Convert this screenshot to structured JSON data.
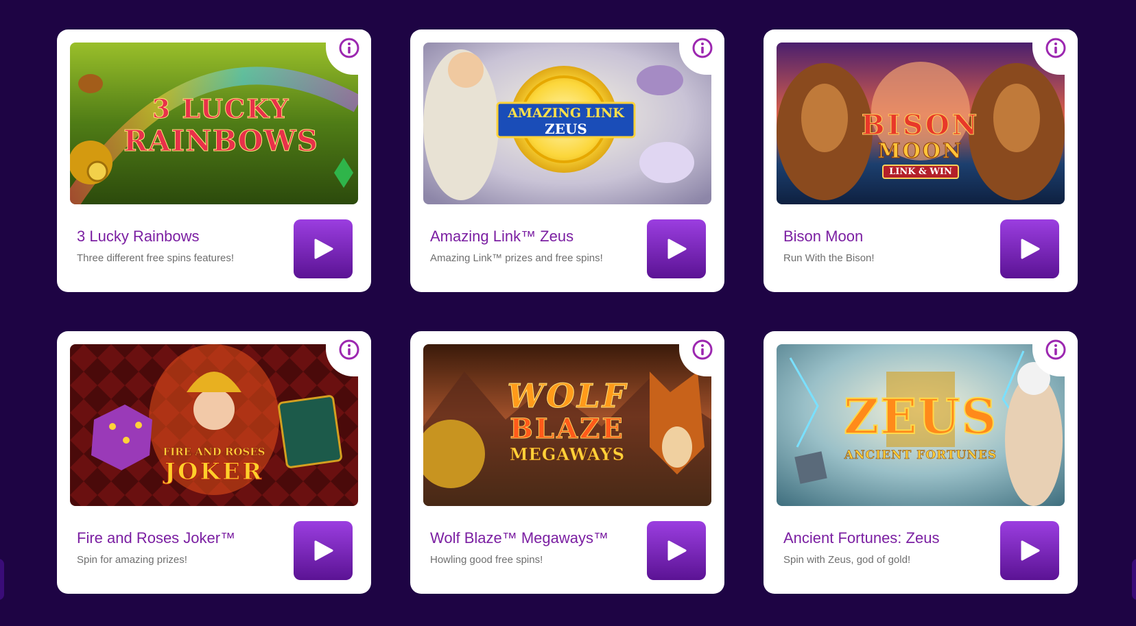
{
  "games": [
    {
      "title": "3 Lucky Rainbows",
      "subtitle": "Three different free spins features!",
      "logo_lines": [
        "3 LUCKY",
        "RAINBOWS"
      ]
    },
    {
      "title": "Amazing Link™ Zeus",
      "subtitle": "Amazing Link™ prizes and free spins!",
      "logo_lines": [
        "AMAZING LINK",
        "ZEUS"
      ]
    },
    {
      "title": "Bison Moon",
      "subtitle": "Run With the Bison!",
      "logo_lines": [
        "BISON",
        "MOON",
        "LINK & WIN"
      ]
    },
    {
      "title": "Fire and Roses Joker™",
      "subtitle": "Spin for amazing prizes!",
      "logo_lines": [
        "FIRE AND ROSES",
        "JOKER"
      ]
    },
    {
      "title": "Wolf Blaze™ Megaways™",
      "subtitle": "Howling good free spins!",
      "logo_lines": [
        "WOLF",
        "BLAZE",
        "MEGAWAYS"
      ]
    },
    {
      "title": "Ancient Fortunes: Zeus",
      "subtitle": "Spin with Zeus, god of gold!",
      "logo_lines": [
        "ZEUS",
        "ANCIENT FORTUNES"
      ]
    }
  ],
  "icons": {
    "info": "info-circle-icon",
    "play": "play-icon"
  },
  "colors": {
    "background": "#1e0444",
    "card": "#ffffff",
    "accent": "#7b1fa2",
    "play_button_top": "#9b3ee0",
    "play_button_bottom": "#5b1394",
    "info_icon": "#9c27b0"
  }
}
